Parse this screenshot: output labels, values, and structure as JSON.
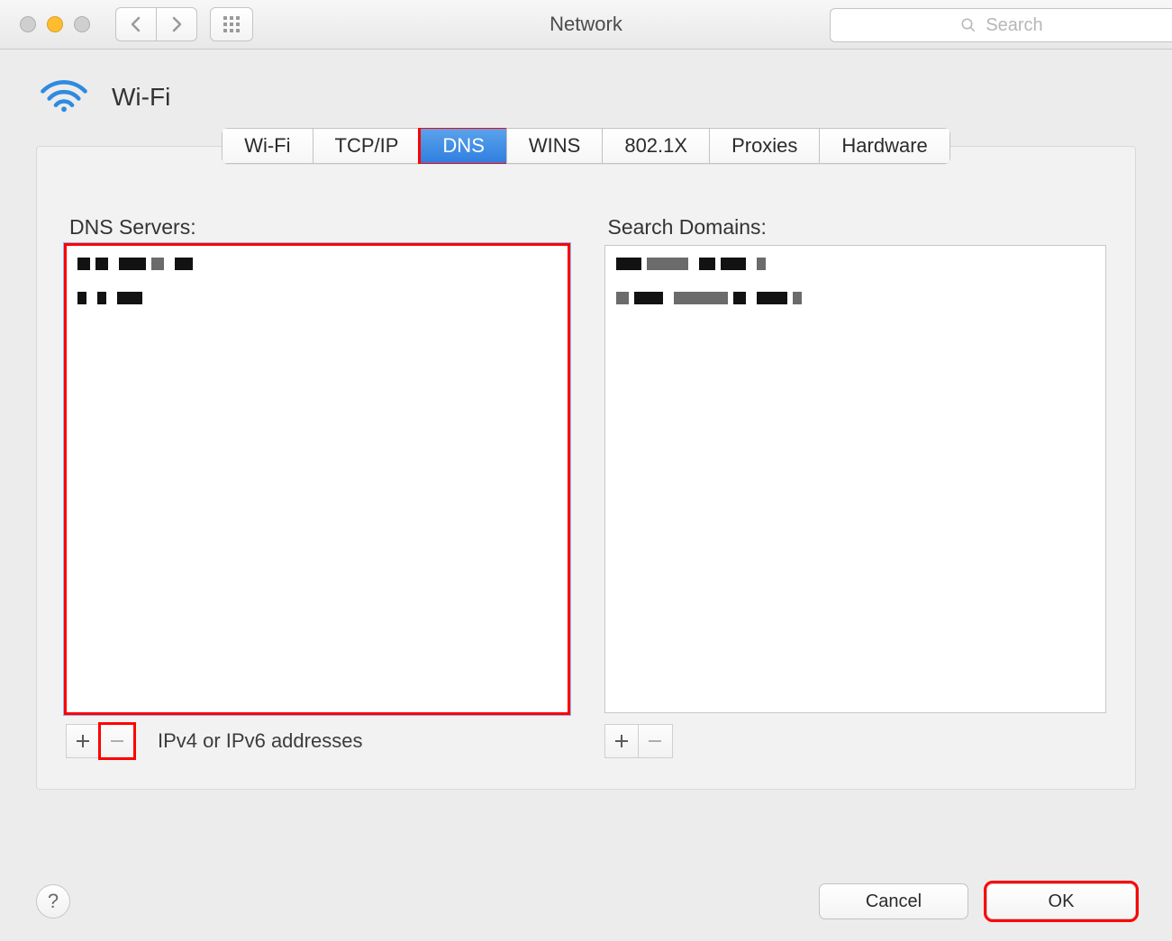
{
  "window": {
    "title": "Network"
  },
  "search": {
    "placeholder": "Search"
  },
  "interface": {
    "name": "Wi-Fi"
  },
  "tabs": [
    {
      "label": "Wi-Fi",
      "active": false
    },
    {
      "label": "TCP/IP",
      "active": false
    },
    {
      "label": "DNS",
      "active": true
    },
    {
      "label": "WINS",
      "active": false
    },
    {
      "label": "802.1X",
      "active": false
    },
    {
      "label": "Proxies",
      "active": false
    },
    {
      "label": "Hardware",
      "active": false
    }
  ],
  "dns": {
    "title": "DNS Servers:",
    "entries_redacted": true,
    "entry_count": 2,
    "footer_note": "IPv4 or IPv6 addresses"
  },
  "search_domains": {
    "title": "Search Domains:",
    "entries_redacted": true,
    "entry_count": 2
  },
  "buttons": {
    "help_tooltip": "?",
    "cancel": "Cancel",
    "ok": "OK"
  }
}
